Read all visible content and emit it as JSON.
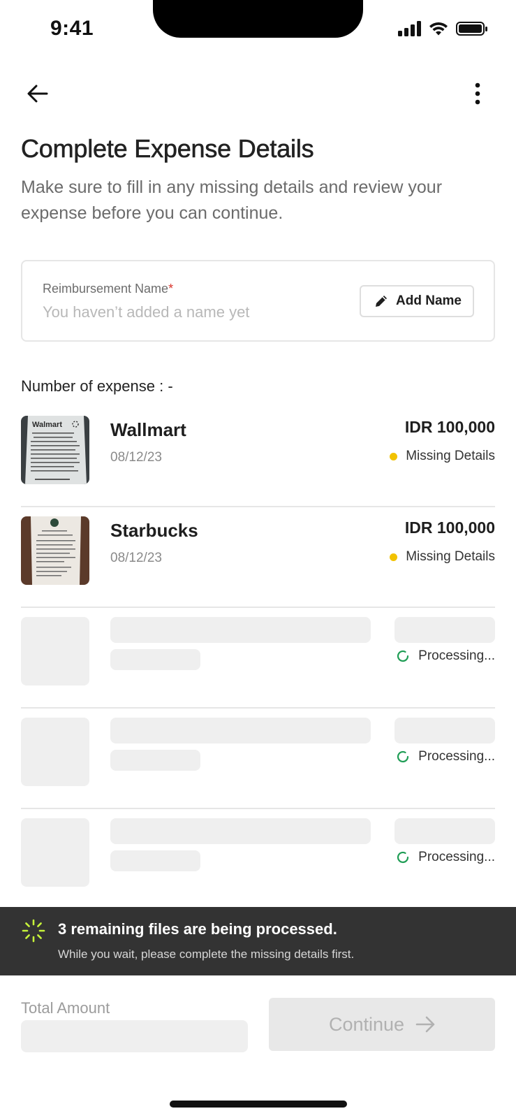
{
  "status_bar": {
    "time": "9:41"
  },
  "header": {
    "title": "Complete Expense Details",
    "subtitle": "Make sure to fill in any missing details and review your expense before you can continue."
  },
  "reimbursement": {
    "label": "Reimbursement Name",
    "required_mark": "*",
    "placeholder": "You haven’t added a name yet",
    "add_button_label": "Add Name"
  },
  "expenses": {
    "count_label": "Number of expense : -",
    "items": [
      {
        "merchant": "Wallmart",
        "date": "08/12/23",
        "amount": "IDR 100,000",
        "status": "Missing Details",
        "status_color": "#f2c200",
        "receipt_brand": "Walmart"
      },
      {
        "merchant": "Starbucks",
        "date": "08/12/23",
        "amount": "IDR 100,000",
        "status": "Missing Details",
        "status_color": "#f2c200"
      }
    ],
    "processing": [
      {
        "status": "Processing..."
      },
      {
        "status": "Processing..."
      },
      {
        "status": "Processing..."
      }
    ]
  },
  "toast": {
    "title": "3 remaining files are being processed.",
    "subtitle": "While you wait, please complete the missing details first.",
    "icon": "loading-spinner-icon",
    "accent_color": "#c6f23a"
  },
  "footer": {
    "total_label": "Total Amount",
    "continue_label": "Continue"
  },
  "colors": {
    "processing_spinner": "#1f9d55",
    "toast_background": "#333333",
    "skeleton": "#efefef"
  }
}
